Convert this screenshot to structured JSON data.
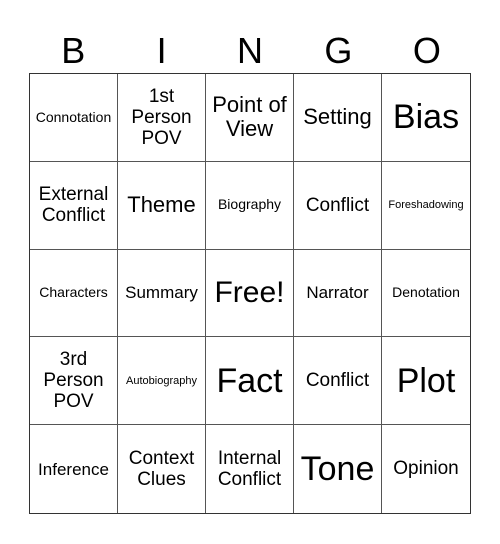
{
  "header": {
    "letters": [
      "B",
      "I",
      "N",
      "G",
      "O"
    ]
  },
  "cells": [
    "Connotation",
    "1st Person POV",
    "Point of View",
    "Setting",
    "Bias",
    "External Conflict",
    "Theme",
    "Biography",
    "Conflict",
    "Foreshadowing",
    "Characters",
    "Summary",
    "Free!",
    "Narrator",
    "Denotation",
    "3rd Person POV",
    "Autobiography",
    "Fact",
    "Conflict",
    "Plot",
    "Inference",
    "Context Clues",
    "Internal Conflict",
    "Tone",
    "Opinion"
  ]
}
